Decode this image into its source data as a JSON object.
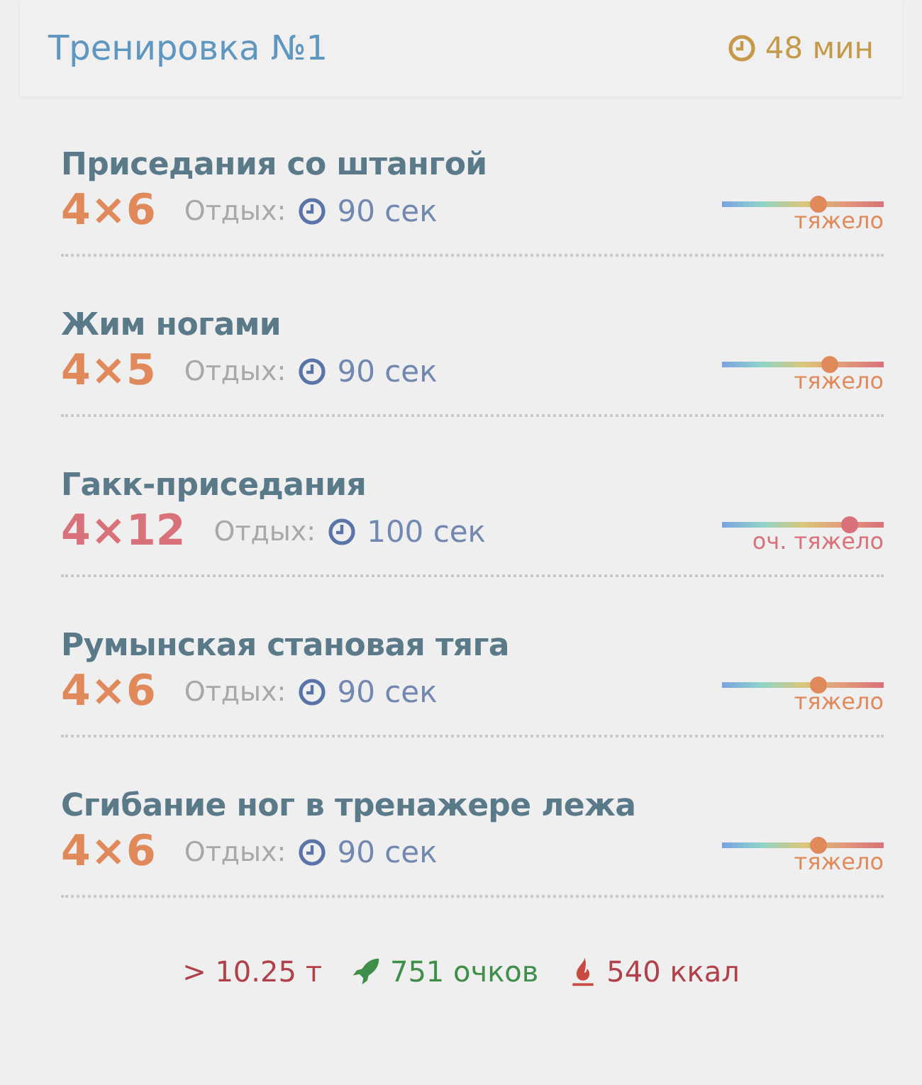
{
  "workout": {
    "title": "Тренировка №1",
    "duration": "48 мин"
  },
  "exercises": [
    {
      "name": "Приседания со штангой",
      "sets": "4×6",
      "rest_label": "Отдых:",
      "rest": "90 сек",
      "intensity": "тяжело",
      "kind": "heavy",
      "level": 0.6
    },
    {
      "name": "Жим ногами",
      "sets": "4×5",
      "rest_label": "Отдых:",
      "rest": "90 сек",
      "intensity": "тяжело",
      "kind": "heavy",
      "level": 0.67
    },
    {
      "name": "Гакк-приседания",
      "sets": "4×12",
      "rest_label": "Отдых:",
      "rest": "100 сек",
      "intensity": "оч. тяжело",
      "kind": "very_heavy",
      "level": 0.79
    },
    {
      "name": "Румынская становая тяга",
      "sets": "4×6",
      "rest_label": "Отдых:",
      "rest": "90 сек",
      "intensity": "тяжело",
      "kind": "heavy",
      "level": 0.6
    },
    {
      "name": "Сгибание ног в тренажере лежа",
      "sets": "4×6",
      "rest_label": "Отдых:",
      "rest": "90 сек",
      "intensity": "тяжело",
      "kind": "heavy",
      "level": 0.6
    }
  ],
  "summary": {
    "tonnage": "> 10.25 т",
    "points": "751 очков",
    "calories": "540 ккал"
  }
}
